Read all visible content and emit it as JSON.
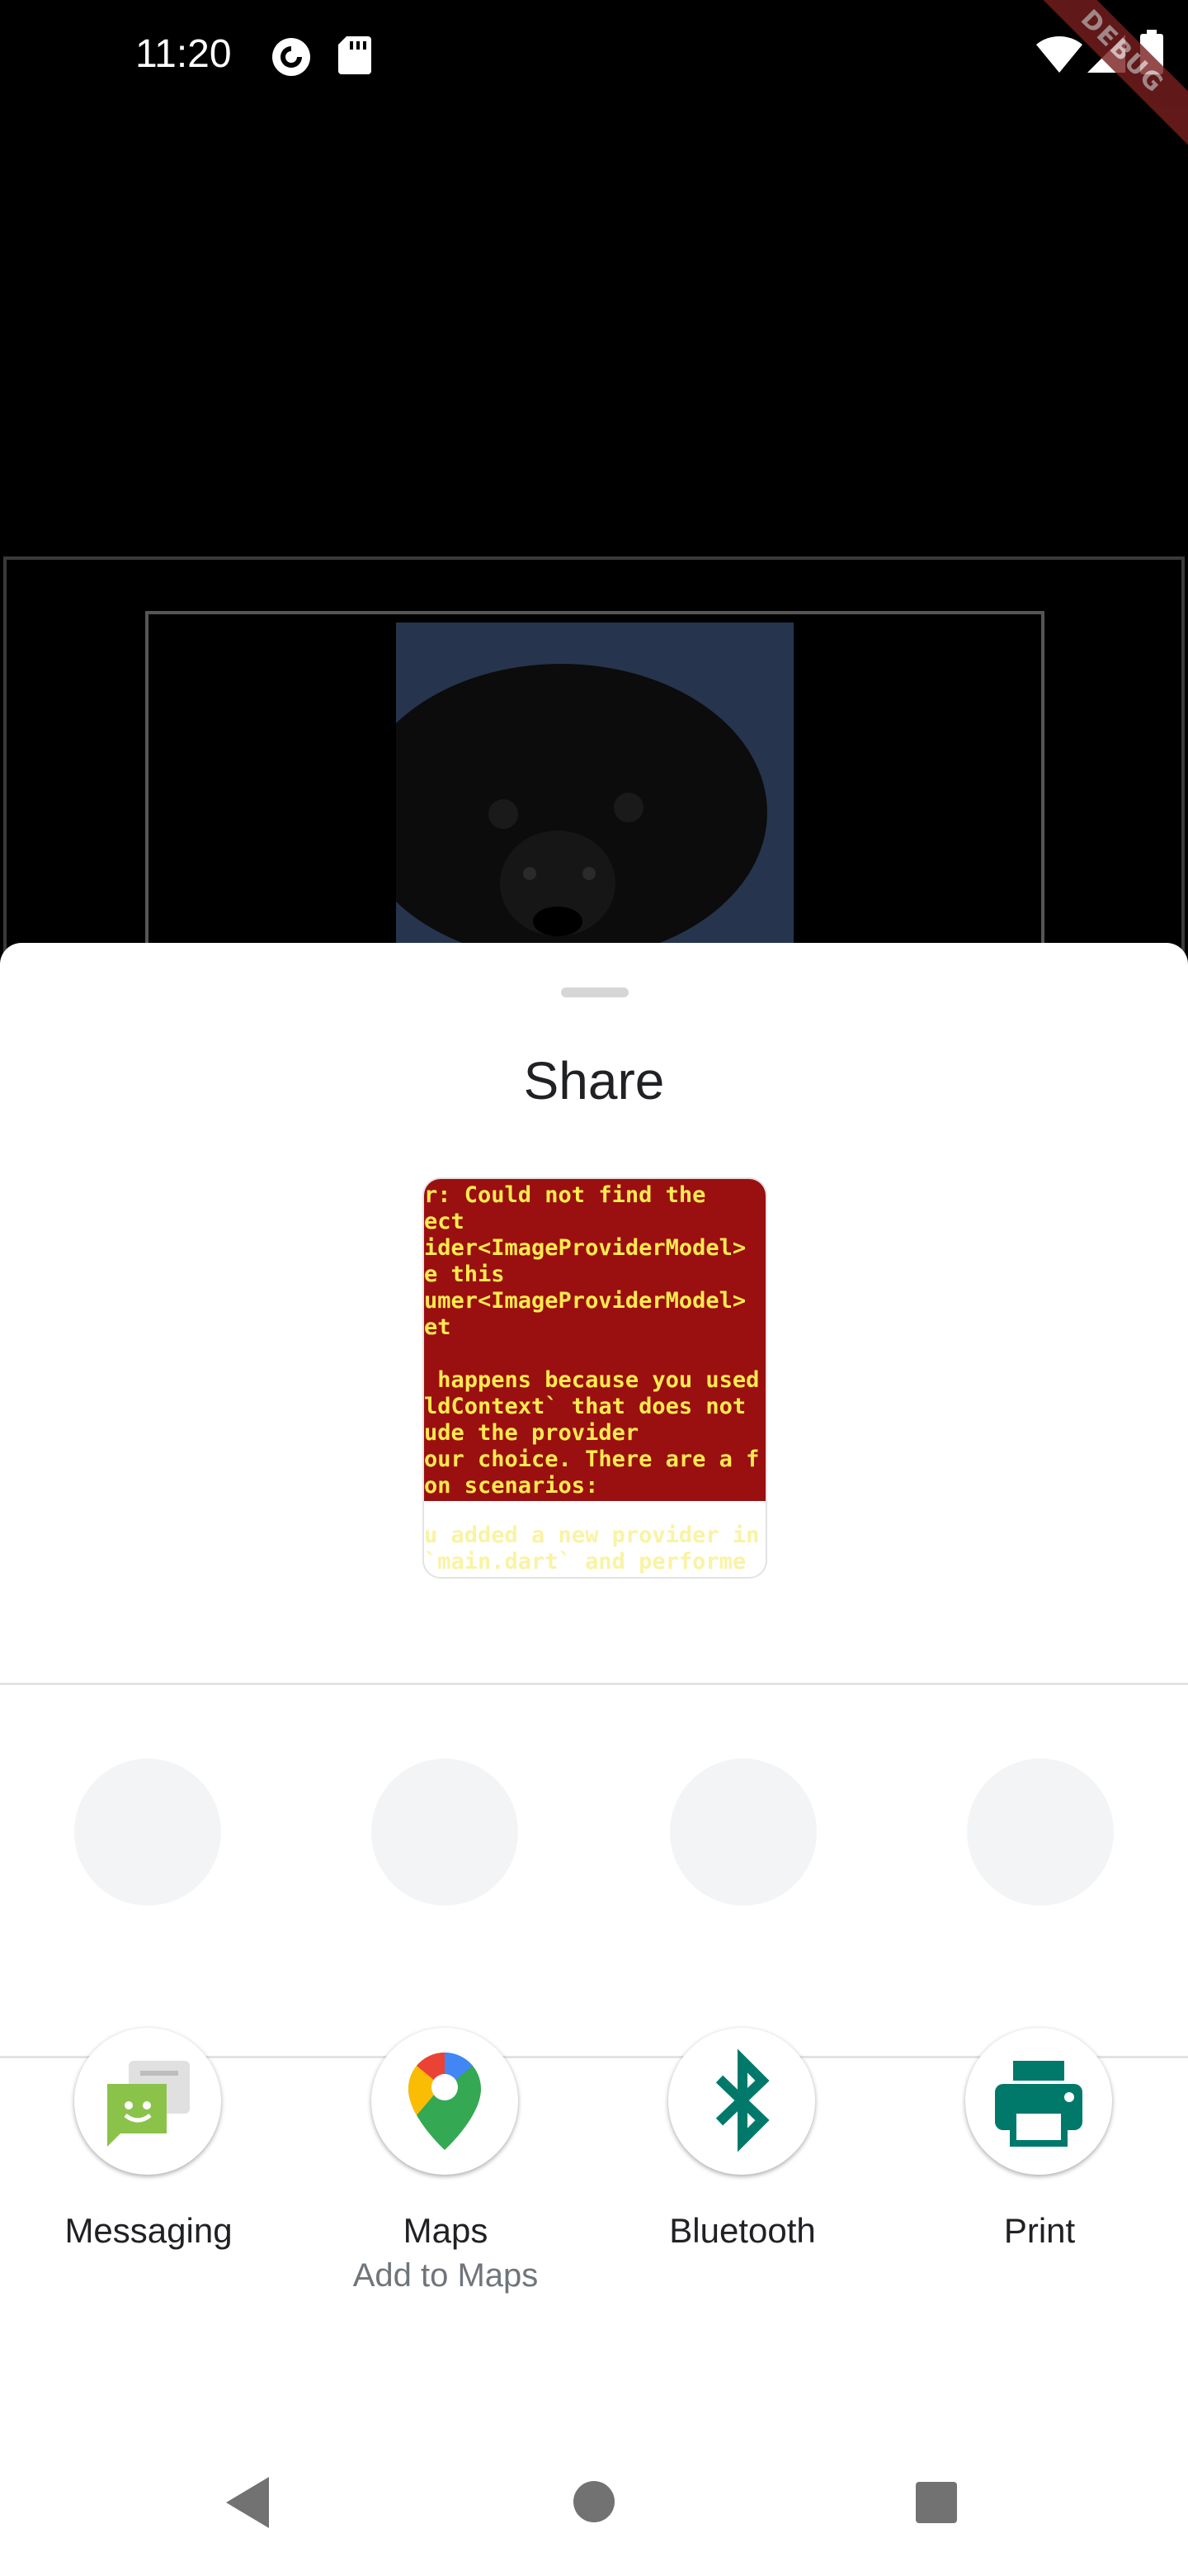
{
  "status_bar": {
    "time": "11:20",
    "debug_banner": "DEBUG",
    "icons": [
      "pocket-casts-icon",
      "sd-card-icon",
      "wifi-icon",
      "cell-signal-icon",
      "battery-icon"
    ]
  },
  "share_sheet": {
    "title": "Share",
    "preview_text": "r: Could not find the\nect\nider<ImageProviderModel>\ne this\numer<ImageProviderModel>\net\n\n happens because you used\nldContext` that does not\nude the provider\nour choice. There are a f\non scenarios:",
    "preview_faded_text": "u added a new provider in\n`main.dart` and performe",
    "targets": [
      {
        "label": "Messaging",
        "sub": "",
        "icon": "messaging-icon"
      },
      {
        "label": "Maps",
        "sub": "Add to Maps",
        "icon": "maps-icon"
      },
      {
        "label": "Bluetooth",
        "sub": "",
        "icon": "bluetooth-icon"
      },
      {
        "label": "Print",
        "sub": "",
        "icon": "print-icon"
      }
    ]
  },
  "colors": {
    "preview_bg": "#9a0f0f",
    "preview_text": "#ffea4f",
    "teal_icon": "#00796b",
    "messaging_green": "#8bc34a"
  }
}
